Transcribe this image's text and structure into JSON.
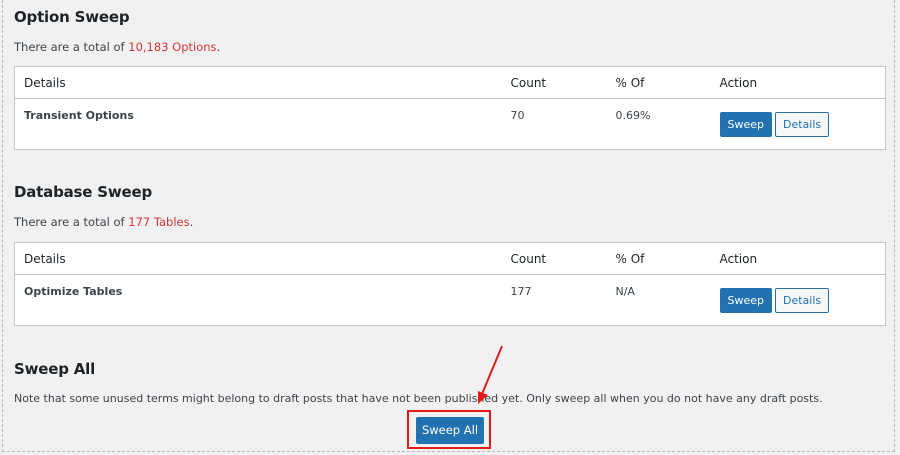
{
  "option_sweep": {
    "title": "Option Sweep",
    "total_prefix": "There are a total of ",
    "total_value": "10,183 Options",
    "total_suffix": ".",
    "columns": [
      "Details",
      "Count",
      "% Of",
      "Action"
    ],
    "row": {
      "name": "Transient Options",
      "count": "70",
      "percent": "0.69%"
    },
    "sweep_label": "Sweep",
    "details_label": "Details"
  },
  "database_sweep": {
    "title": "Database Sweep",
    "total_prefix": "There are a total of ",
    "total_value": "177 Tables",
    "total_suffix": ".",
    "columns": [
      "Details",
      "Count",
      "% Of",
      "Action"
    ],
    "row": {
      "name": "Optimize Tables",
      "count": "177",
      "percent": "N/A"
    },
    "sweep_label": "Sweep",
    "details_label": "Details"
  },
  "sweep_all": {
    "title": "Sweep All",
    "note": "Note that some unused terms might belong to draft posts that have not been published yet. Only sweep all when you do not have any draft posts.",
    "button_label": "Sweep All"
  },
  "colors": {
    "accent": "#2271b1",
    "highlight": "#d63638",
    "annotation": "#e01b1b"
  }
}
